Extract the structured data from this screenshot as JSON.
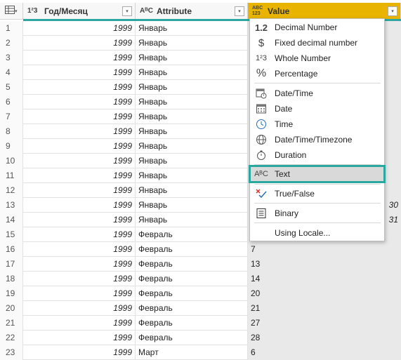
{
  "headers": [
    {
      "type_icon": "1²3",
      "title": "Год/Месяц"
    },
    {
      "type_icon": "AᴮC",
      "title": "Attribute"
    },
    {
      "type_icon": "ABC 123",
      "title": "Value"
    }
  ],
  "dropdown_glyph": "▾",
  "rows": [
    {
      "n": "1",
      "year": "1999",
      "attr": "Январь",
      "value": "",
      "tail": ""
    },
    {
      "n": "2",
      "year": "1999",
      "attr": "Январь",
      "value": "",
      "tail": ""
    },
    {
      "n": "3",
      "year": "1999",
      "attr": "Январь",
      "value": "",
      "tail": ""
    },
    {
      "n": "4",
      "year": "1999",
      "attr": "Январь",
      "value": "",
      "tail": ""
    },
    {
      "n": "5",
      "year": "1999",
      "attr": "Январь",
      "value": "",
      "tail": ""
    },
    {
      "n": "6",
      "year": "1999",
      "attr": "Январь",
      "value": "",
      "tail": ""
    },
    {
      "n": "7",
      "year": "1999",
      "attr": "Январь",
      "value": "",
      "tail": ""
    },
    {
      "n": "8",
      "year": "1999",
      "attr": "Январь",
      "value": "",
      "tail": ""
    },
    {
      "n": "9",
      "year": "1999",
      "attr": "Январь",
      "value": "",
      "tail": ""
    },
    {
      "n": "10",
      "year": "1999",
      "attr": "Январь",
      "value": "",
      "tail": ""
    },
    {
      "n": "11",
      "year": "1999",
      "attr": "Январь",
      "value": "",
      "tail": ""
    },
    {
      "n": "12",
      "year": "1999",
      "attr": "Январь",
      "value": "",
      "tail": ""
    },
    {
      "n": "13",
      "year": "1999",
      "attr": "Январь",
      "value": "",
      "tail": "30"
    },
    {
      "n": "14",
      "year": "1999",
      "attr": "Январь",
      "value": "",
      "tail": "31"
    },
    {
      "n": "15",
      "year": "1999",
      "attr": "Февраль",
      "value": "",
      "tail": ""
    },
    {
      "n": "16",
      "year": "1999",
      "attr": "Февраль",
      "value": "7",
      "tail": ""
    },
    {
      "n": "17",
      "year": "1999",
      "attr": "Февраль",
      "value": "13",
      "tail": ""
    },
    {
      "n": "18",
      "year": "1999",
      "attr": "Февраль",
      "value": "14",
      "tail": ""
    },
    {
      "n": "19",
      "year": "1999",
      "attr": "Февраль",
      "value": "20",
      "tail": ""
    },
    {
      "n": "20",
      "year": "1999",
      "attr": "Февраль",
      "value": "21",
      "tail": ""
    },
    {
      "n": "21",
      "year": "1999",
      "attr": "Февраль",
      "value": "27",
      "tail": ""
    },
    {
      "n": "22",
      "year": "1999",
      "attr": "Февраль",
      "value": "28",
      "tail": ""
    },
    {
      "n": "23",
      "year": "1999",
      "attr": "Март",
      "value": "6",
      "tail": ""
    }
  ],
  "menu": [
    {
      "icon": "1.2",
      "label": "Decimal Number"
    },
    {
      "icon": "$",
      "label": "Fixed decimal number"
    },
    {
      "icon": "1²3",
      "label": "Whole Number"
    },
    {
      "icon": "%",
      "label": "Percentage"
    },
    {
      "icon": "datetime-icon",
      "label": "Date/Time"
    },
    {
      "icon": "date-icon",
      "label": "Date"
    },
    {
      "icon": "time-icon",
      "label": "Time"
    },
    {
      "icon": "globe-icon",
      "label": "Date/Time/Timezone"
    },
    {
      "icon": "stopwatch-icon",
      "label": "Duration"
    },
    {
      "icon": "AᴮC",
      "label": "Text"
    },
    {
      "icon": "truefalse-icon",
      "label": "True/False"
    },
    {
      "icon": "binary-icon",
      "label": "Binary"
    },
    {
      "icon": "",
      "label": "Using Locale..."
    }
  ],
  "colors": {
    "accent_teal": "#2aa7a0",
    "selected_header": "#e8b400"
  }
}
